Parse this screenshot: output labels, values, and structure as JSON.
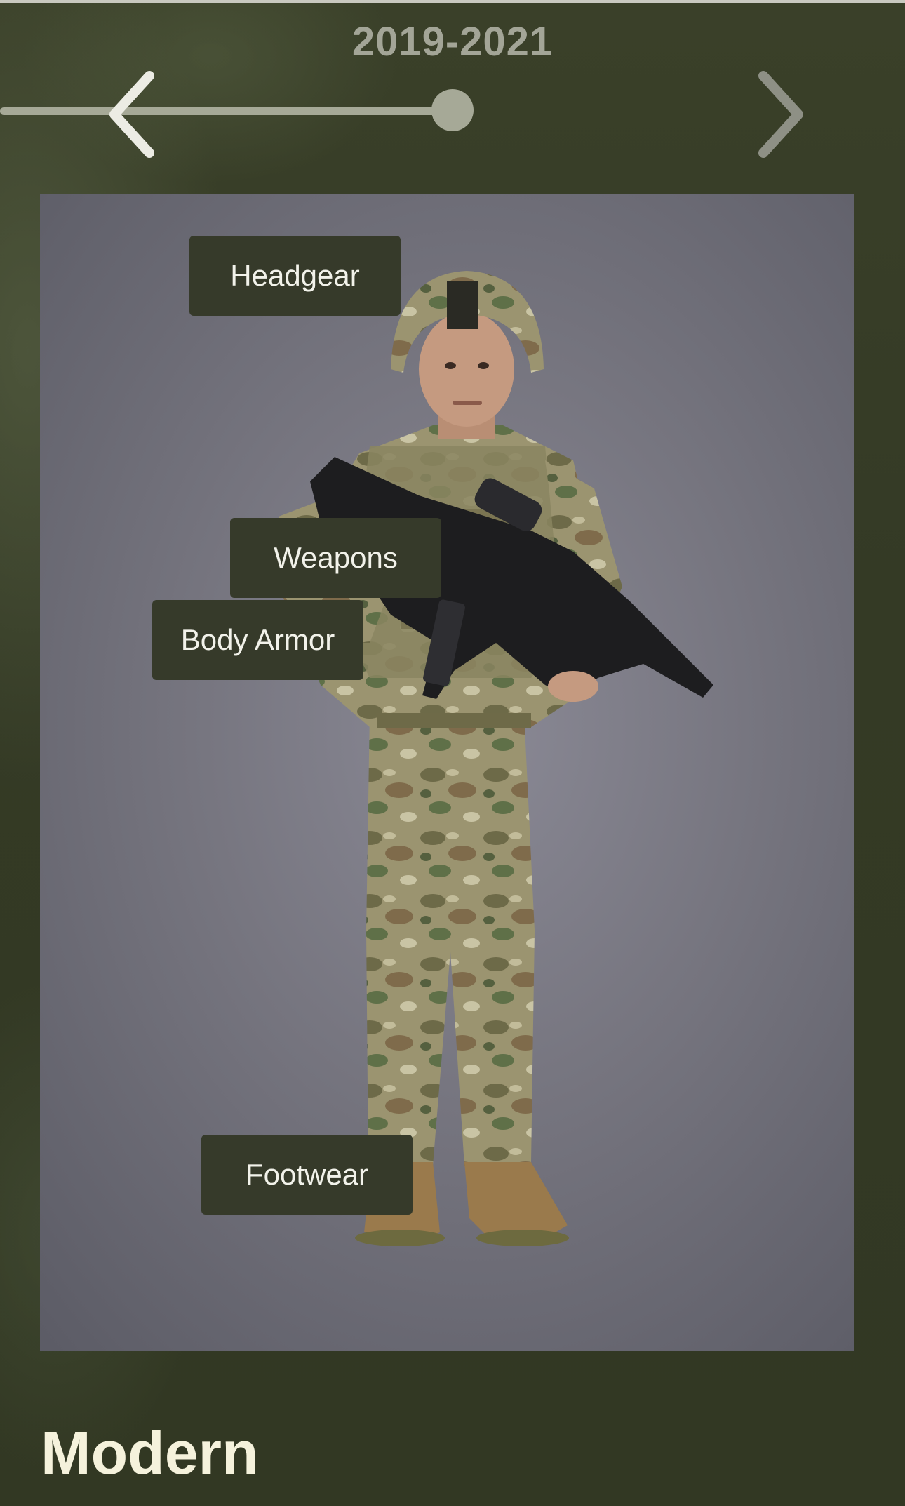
{
  "timeline": {
    "year_range": "2019-2021",
    "prev_icon": "chevron-left-icon",
    "next_icon": "chevron-right-icon"
  },
  "photo": {
    "hotspots": {
      "headgear": "Headgear",
      "weapons": "Weapons",
      "body_armor": "Body Armor",
      "footwear": "Footwear"
    }
  },
  "era": {
    "title": "Modern"
  },
  "colors": {
    "background": "#353b26",
    "accent": "#a6a997",
    "label_bg": "#363a2a",
    "title_text": "#f5f2dc"
  }
}
